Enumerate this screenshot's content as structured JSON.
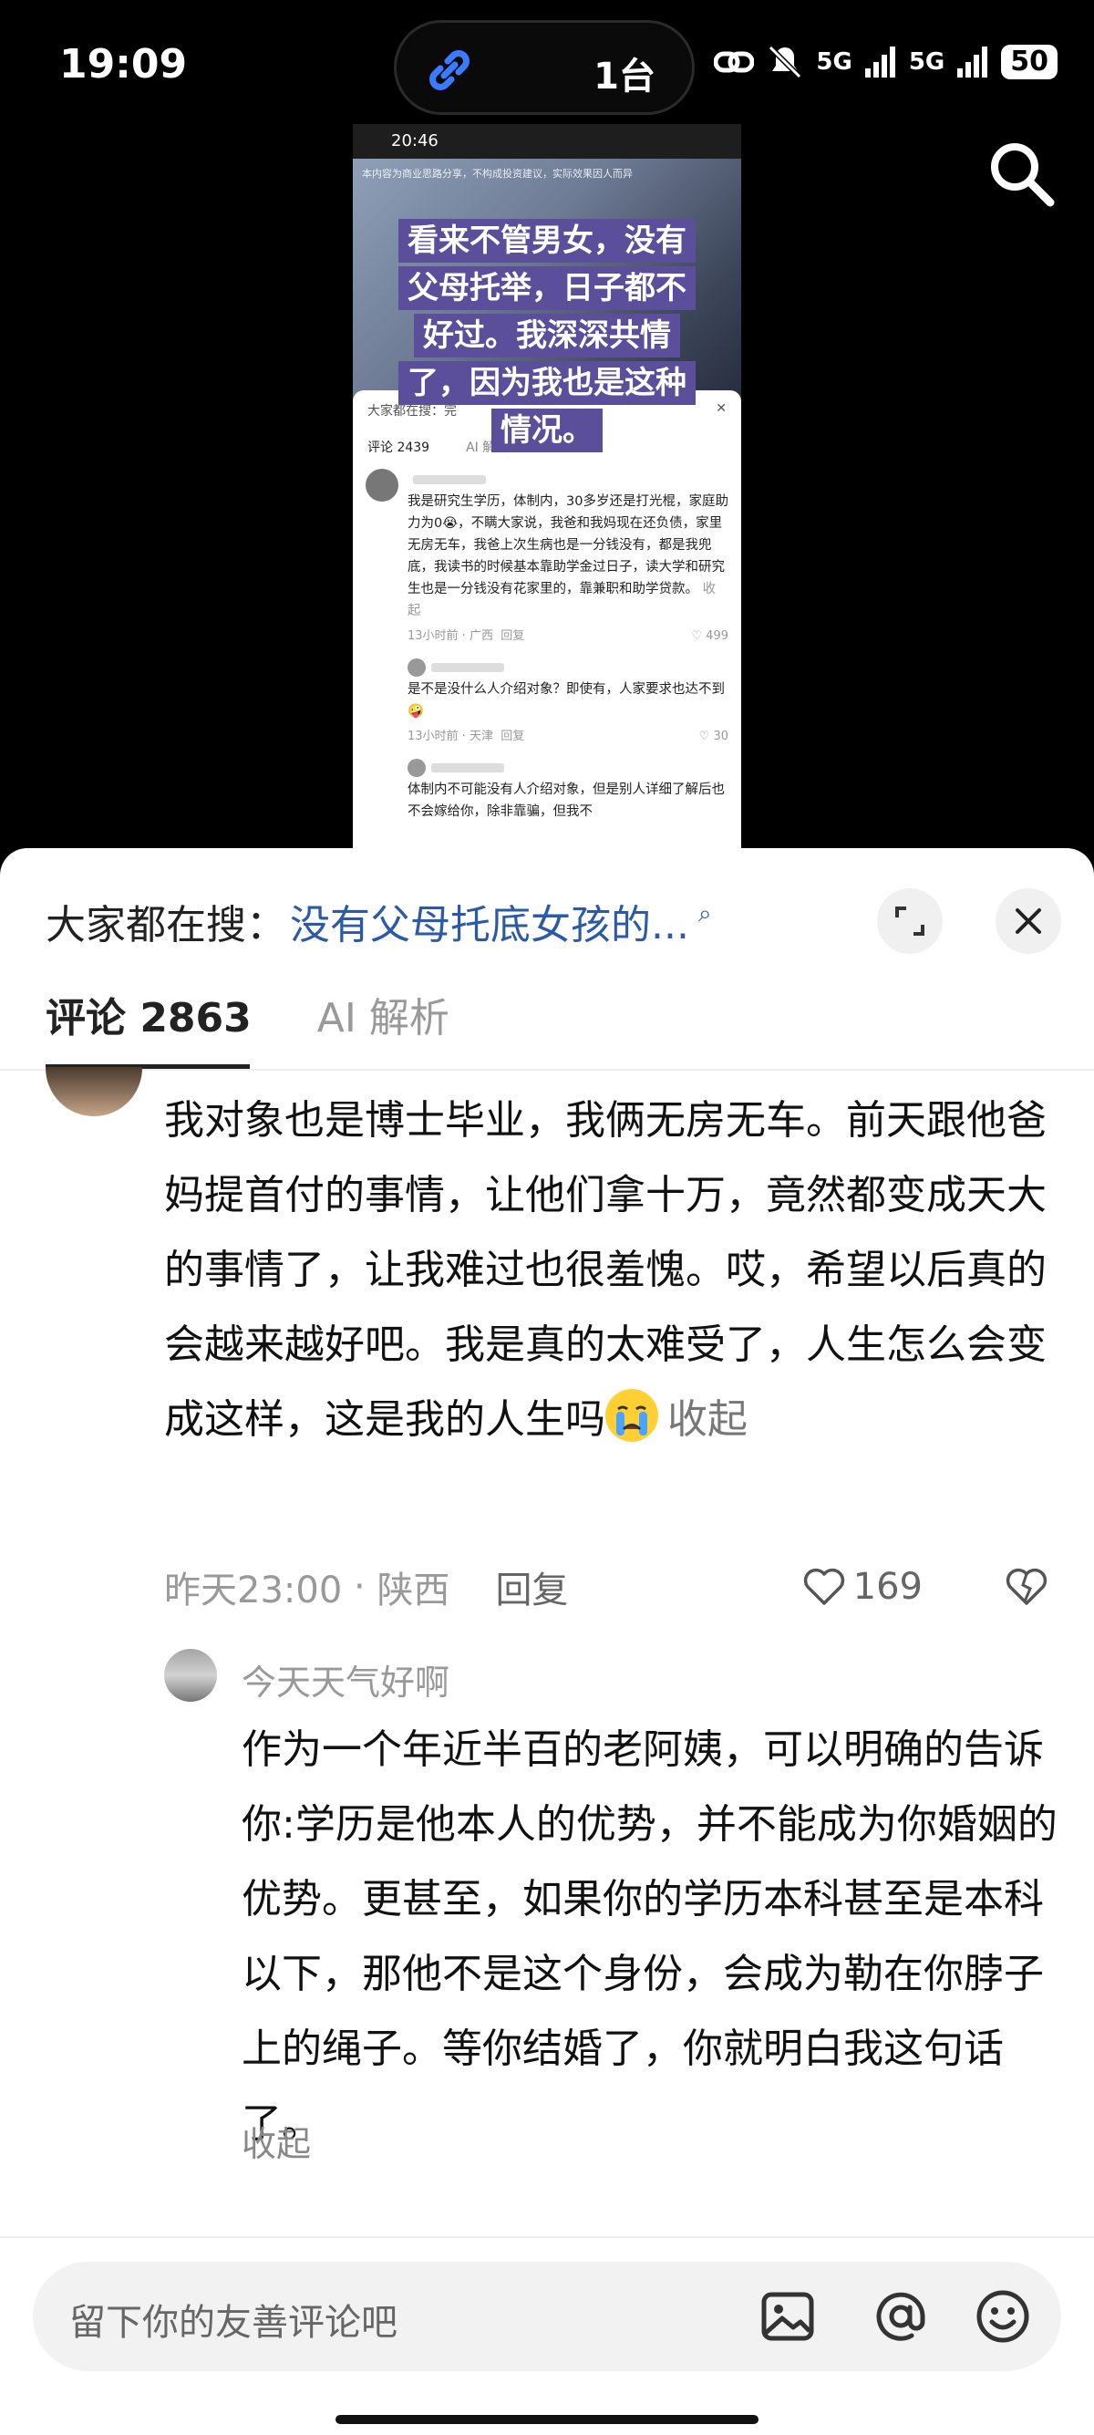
{
  "status_bar": {
    "time": "19:09",
    "island_count": "1台",
    "network_1": "5G",
    "network_2": "5G",
    "battery": "50"
  },
  "embedded_screenshot": {
    "time": "20:46",
    "video_top_text": "本内容为商业思路分享，不构成投资建议，实际效果因人而异",
    "caption": [
      "看来不管男女，没有",
      "父母托举，日子都不",
      "好过。我深深共情",
      "了，因为我也是这种",
      "情况。"
    ],
    "sheet_header": "大家都在搜：完",
    "tabs": [
      "评论 2439",
      "AI 解析"
    ],
    "comment": "我是研究生学历，体制内，30多岁还是打光棍，家庭助力为0😭，不瞒大家说，我爸和我妈现在还负债，家里无房无车，我爸上次生病也是一分钱没有，都是我兜底，我读书的时候基本靠助学金过日子，读大学和研究生也是一分钱没有花家里的，靠兼职和助学贷款。",
    "comment_collapse": "收起",
    "comment_meta": "13小时前 · 广西",
    "comment_reply": "回复",
    "comment_likes": "499",
    "reply1": "是不是没什么人介绍对象？即使有，人家要求也达不到🤪",
    "reply1_meta": "13小时前 · 天津",
    "reply1_reply": "回复",
    "reply1_likes": "30",
    "reply2": "体制内不可能没有人介绍对象，但是别人详细了解后也不会嫁给你，除非靠骗，但我不"
  },
  "sheet": {
    "search_label": "大家都在搜：",
    "search_query": "没有父母托底女孩的...",
    "tabs": [
      {
        "label": "评论 2863"
      },
      {
        "label": "AI 解析"
      }
    ]
  },
  "comment": {
    "text": "我对象也是博士毕业，我俩无房无车。前天跟他爸妈提首付的事情，让他们拿十万，竟然都变成天大的事情了，让我难过也很羞愧。哎，希望以后真的会越来越好吧。我是真的太难受了，人生怎么会变成这样，这是我的人生吗",
    "collapse": "收起",
    "time": "昨天23:00",
    "location": "陕西",
    "reply": "回复",
    "likes": "169"
  },
  "sub_comment": {
    "author": "今天天气好啊",
    "text": "作为一个年近半百的老阿姨，可以明确的告诉你:学历是他本人的优势，并不能成为你婚姻的优势。更甚至，如果你的学历本科甚至是本科以下，那他不是这个身份，会成为勒在你脖子上的绳子。等你结婚了，你就明白我这句话了。",
    "collapse": "收起"
  },
  "input": {
    "placeholder": "留下你的友善评论吧"
  },
  "colors": {
    "link": "#2b5aa6",
    "caption_bg": "#5b4f9b"
  },
  "icons": [
    "link-icon",
    "search-icon",
    "expand-icon",
    "close-icon",
    "image-icon",
    "at-icon",
    "emoji-icon",
    "heart-icon",
    "dislike-icon"
  ]
}
